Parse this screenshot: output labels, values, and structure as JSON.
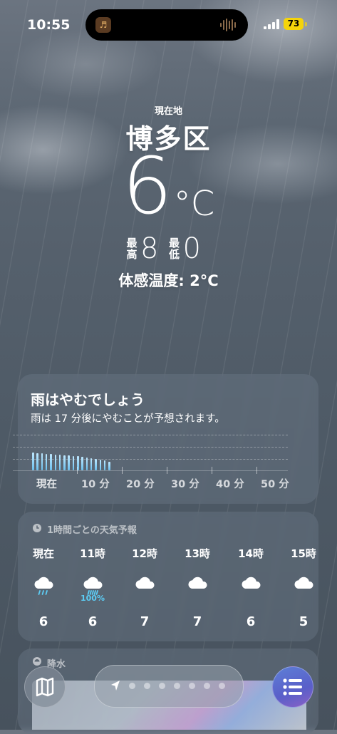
{
  "status_bar": {
    "time": "10:55",
    "battery": "73"
  },
  "current": {
    "location_label": "現在地",
    "city": "博多区",
    "temperature": "6",
    "unit": "°C",
    "high_label": "最高",
    "high": "8",
    "low_label": "最低",
    "low": "0",
    "feels_like": "体感温度: 2°C"
  },
  "precip_card": {
    "title": "雨はやむでしょう",
    "subtitle": "雨は 17 分後にやむことが予想されます。",
    "axis_labels": [
      "現在",
      "10 分",
      "20 分",
      "30 分",
      "40 分",
      "50 分"
    ],
    "intensity_minutes_0_to_17": [
      0.95,
      0.93,
      0.92,
      0.9,
      0.88,
      0.86,
      0.84,
      0.82,
      0.8,
      0.78,
      0.76,
      0.73,
      0.7,
      0.67,
      0.63,
      0.58,
      0.52,
      0.45
    ]
  },
  "hourly_card": {
    "title": "1時間ごとの天気予報",
    "hours": [
      {
        "time": "現在",
        "icon": "rain-cloud-icon",
        "prob": "",
        "temp": "6"
      },
      {
        "time": "11時",
        "icon": "heavy-rain-cloud-icon",
        "prob": "100%",
        "temp": "6"
      },
      {
        "time": "12時",
        "icon": "cloud-icon",
        "prob": "",
        "temp": "7"
      },
      {
        "time": "13時",
        "icon": "cloud-icon",
        "prob": "",
        "temp": "7"
      },
      {
        "time": "14時",
        "icon": "cloud-icon",
        "prob": "",
        "temp": "6"
      },
      {
        "time": "15時",
        "icon": "cloud-icon",
        "prob": "",
        "temp": "5"
      }
    ]
  },
  "precip_map_card": {
    "title": "降水"
  },
  "toolbar": {
    "map_button": "map-icon",
    "list_button": "list-icon",
    "page_count": 7
  },
  "colors": {
    "accent_rain": "#5ccdf5",
    "battery": "#f5d40a"
  }
}
